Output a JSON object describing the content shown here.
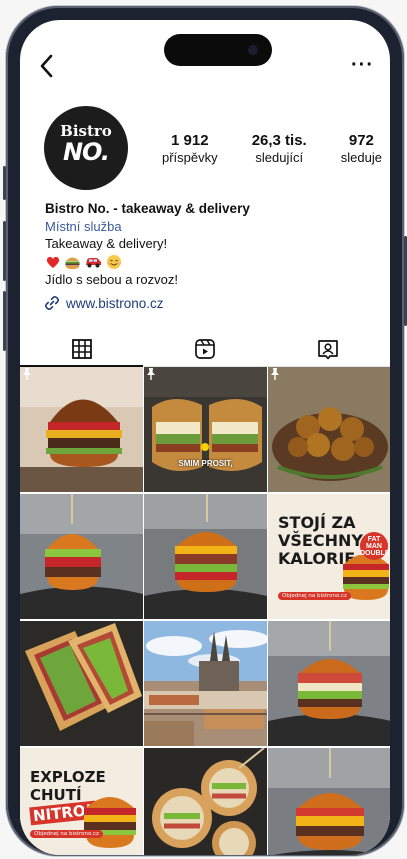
{
  "profile": {
    "stats": [
      {
        "number": "1 912",
        "label": "příspěvky"
      },
      {
        "number": "26,3 tis.",
        "label": "sledující"
      },
      {
        "number": "972",
        "label": "sleduje"
      }
    ],
    "avatar_line1": "Bistro",
    "avatar_line2": "NO.",
    "name": "Bistro No. - takeaway & delivery",
    "category": "Místní služba",
    "bio_line1": "Takeaway & delivery!",
    "bio_line3": "Jídlo s sebou a rozvoz!",
    "website": "www.bistrono.cz"
  },
  "posts": {
    "tile2_subtitle": "SMIM PROSIT,",
    "poster1_text": [
      "STOJÍ ZA",
      "VŠECHNY",
      "KALORIE"
    ],
    "poster1_badge": [
      "FAT",
      "MAN",
      "DOUBLE"
    ],
    "poster1_button": "Objednej na bistrono.cz",
    "poster2_text": [
      "EXPLOZE",
      "CHUTÍ",
      "NITRO!"
    ],
    "poster2_button": "Objednej na bistrono.cz"
  },
  "colors": {
    "link": "#1f3d7a",
    "category": "#3d5a99",
    "poster_red": "#d7342a",
    "poster_bg": "#f3ece1"
  },
  "icons": [
    "back-arrow-icon",
    "more-dots-icon",
    "grid-icon",
    "reels-icon",
    "tagged-icon",
    "link-icon",
    "pin-icon"
  ]
}
